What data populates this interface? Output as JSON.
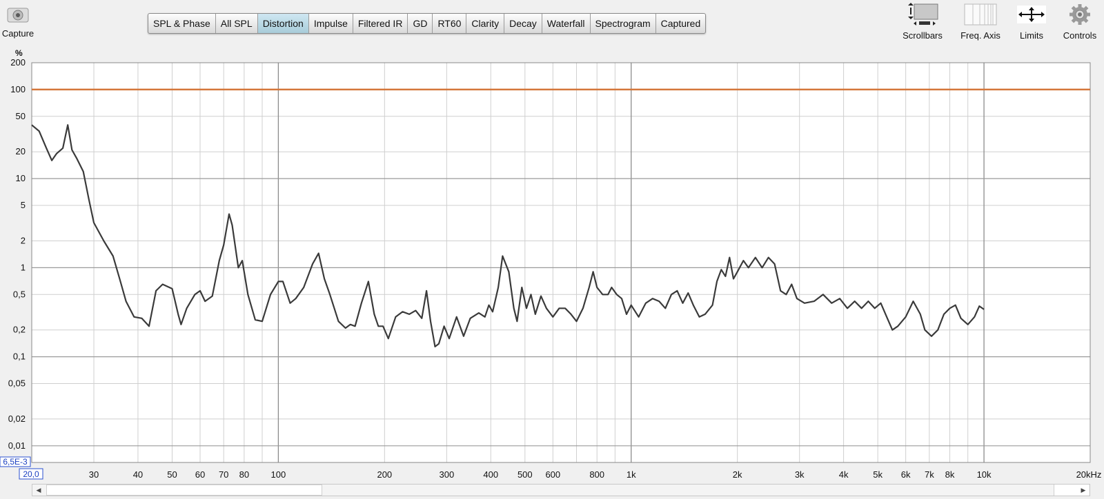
{
  "toolbar": {
    "capture_label": "Capture",
    "tabs": [
      {
        "label": "SPL & Phase",
        "active": false
      },
      {
        "label": "All SPL",
        "active": false
      },
      {
        "label": "Distortion",
        "active": true
      },
      {
        "label": "Impulse",
        "active": false
      },
      {
        "label": "Filtered IR",
        "active": false
      },
      {
        "label": "GD",
        "active": false
      },
      {
        "label": "RT60",
        "active": false
      },
      {
        "label": "Clarity",
        "active": false
      },
      {
        "label": "Decay",
        "active": false
      },
      {
        "label": "Waterfall",
        "active": false
      },
      {
        "label": "Spectrogram",
        "active": false
      },
      {
        "label": "Captured",
        "active": false
      }
    ],
    "right_tools": [
      {
        "label": "Scrollbars",
        "icon": "scrollbars-icon"
      },
      {
        "label": "Freq. Axis",
        "icon": "freq-axis-icon"
      },
      {
        "label": "Limits",
        "icon": "limits-icon"
      },
      {
        "label": "Controls",
        "icon": "gear-icon"
      }
    ]
  },
  "chart": {
    "y_unit": "%",
    "y_min_label": "6,5E-3",
    "x_min_label": "20,0",
    "x_max_label": "20kHz"
  },
  "chart_data": {
    "type": "line",
    "title": "",
    "xlabel": "",
    "ylabel": "%",
    "x_scale": "log",
    "y_scale": "log",
    "xlim": [
      20,
      20000
    ],
    "ylim": [
      0.0065,
      200
    ],
    "grid": true,
    "x_ticks": [
      {
        "v": 30,
        "label": "30"
      },
      {
        "v": 40,
        "label": "40"
      },
      {
        "v": 50,
        "label": "50"
      },
      {
        "v": 60,
        "label": "60"
      },
      {
        "v": 70,
        "label": "70"
      },
      {
        "v": 80,
        "label": "80"
      },
      {
        "v": 100,
        "label": "100"
      },
      {
        "v": 200,
        "label": "200"
      },
      {
        "v": 300,
        "label": "300"
      },
      {
        "v": 400,
        "label": "400"
      },
      {
        "v": 500,
        "label": "500"
      },
      {
        "v": 600,
        "label": "600"
      },
      {
        "v": 800,
        "label": "800"
      },
      {
        "v": 1000,
        "label": "1k"
      },
      {
        "v": 2000,
        "label": "2k"
      },
      {
        "v": 3000,
        "label": "3k"
      },
      {
        "v": 4000,
        "label": "4k"
      },
      {
        "v": 5000,
        "label": "5k"
      },
      {
        "v": 6000,
        "label": "6k"
      },
      {
        "v": 7000,
        "label": "7k"
      },
      {
        "v": 8000,
        "label": "8k"
      },
      {
        "v": 10000,
        "label": "10k"
      }
    ],
    "y_ticks": [
      {
        "v": 200,
        "label": "200"
      },
      {
        "v": 100,
        "label": "100"
      },
      {
        "v": 50,
        "label": "50"
      },
      {
        "v": 20,
        "label": "20"
      },
      {
        "v": 10,
        "label": "10"
      },
      {
        "v": 5,
        "label": "5"
      },
      {
        "v": 2,
        "label": "2"
      },
      {
        "v": 1,
        "label": "1"
      },
      {
        "v": 0.5,
        "label": "0,5"
      },
      {
        "v": 0.2,
        "label": "0,2"
      },
      {
        "v": 0.1,
        "label": "0,1"
      },
      {
        "v": 0.05,
        "label": "0,05"
      },
      {
        "v": 0.02,
        "label": "0,02"
      },
      {
        "v": 0.01,
        "label": "0,01"
      }
    ],
    "reference_line": {
      "y": 100,
      "color": "#d4763a"
    },
    "series": [
      {
        "color": "#3a3a3a",
        "points": [
          [
            20,
            40
          ],
          [
            21,
            34
          ],
          [
            22,
            22
          ],
          [
            22.8,
            16
          ],
          [
            23.5,
            19
          ],
          [
            24.5,
            22
          ],
          [
            25.3,
            40
          ],
          [
            26,
            21
          ],
          [
            26.8,
            17
          ],
          [
            28,
            12
          ],
          [
            29,
            6
          ],
          [
            30,
            3.2
          ],
          [
            32,
            2.0
          ],
          [
            34,
            1.35
          ],
          [
            35.5,
            0.75
          ],
          [
            37,
            0.42
          ],
          [
            39,
            0.28
          ],
          [
            41,
            0.27
          ],
          [
            43,
            0.22
          ],
          [
            45,
            0.55
          ],
          [
            47,
            0.65
          ],
          [
            50,
            0.58
          ],
          [
            52,
            0.3
          ],
          [
            53,
            0.23
          ],
          [
            55,
            0.35
          ],
          [
            58,
            0.5
          ],
          [
            60,
            0.55
          ],
          [
            62,
            0.42
          ],
          [
            65,
            0.48
          ],
          [
            68,
            1.2
          ],
          [
            70,
            1.8
          ],
          [
            72.5,
            4.0
          ],
          [
            74,
            3.0
          ],
          [
            77,
            1.0
          ],
          [
            79,
            1.2
          ],
          [
            82,
            0.5
          ],
          [
            86,
            0.26
          ],
          [
            90,
            0.25
          ],
          [
            95,
            0.5
          ],
          [
            100,
            0.7
          ],
          [
            103,
            0.7
          ],
          [
            108,
            0.4
          ],
          [
            112,
            0.45
          ],
          [
            118,
            0.6
          ],
          [
            125,
            1.1
          ],
          [
            130,
            1.45
          ],
          [
            135,
            0.75
          ],
          [
            140,
            0.5
          ],
          [
            148,
            0.25
          ],
          [
            155,
            0.21
          ],
          [
            160,
            0.23
          ],
          [
            165,
            0.22
          ],
          [
            172,
            0.4
          ],
          [
            180,
            0.7
          ],
          [
            187,
            0.3
          ],
          [
            192,
            0.22
          ],
          [
            198,
            0.22
          ],
          [
            205,
            0.16
          ],
          [
            215,
            0.28
          ],
          [
            225,
            0.32
          ],
          [
            235,
            0.3
          ],
          [
            245,
            0.33
          ],
          [
            255,
            0.27
          ],
          [
            263,
            0.55
          ],
          [
            270,
            0.25
          ],
          [
            278,
            0.13
          ],
          [
            285,
            0.14
          ],
          [
            295,
            0.22
          ],
          [
            305,
            0.16
          ],
          [
            320,
            0.28
          ],
          [
            335,
            0.17
          ],
          [
            350,
            0.27
          ],
          [
            370,
            0.31
          ],
          [
            385,
            0.28
          ],
          [
            395,
            0.38
          ],
          [
            405,
            0.32
          ],
          [
            420,
            0.6
          ],
          [
            432,
            1.35
          ],
          [
            450,
            0.9
          ],
          [
            465,
            0.35
          ],
          [
            475,
            0.25
          ],
          [
            490,
            0.6
          ],
          [
            505,
            0.35
          ],
          [
            520,
            0.5
          ],
          [
            535,
            0.3
          ],
          [
            555,
            0.48
          ],
          [
            575,
            0.35
          ],
          [
            600,
            0.28
          ],
          [
            625,
            0.35
          ],
          [
            650,
            0.35
          ],
          [
            675,
            0.3
          ],
          [
            700,
            0.25
          ],
          [
            730,
            0.35
          ],
          [
            760,
            0.6
          ],
          [
            780,
            0.9
          ],
          [
            800,
            0.6
          ],
          [
            830,
            0.5
          ],
          [
            860,
            0.5
          ],
          [
            880,
            0.6
          ],
          [
            910,
            0.5
          ],
          [
            940,
            0.45
          ],
          [
            970,
            0.3
          ],
          [
            1000,
            0.38
          ],
          [
            1050,
            0.28
          ],
          [
            1100,
            0.4
          ],
          [
            1150,
            0.45
          ],
          [
            1200,
            0.42
          ],
          [
            1250,
            0.35
          ],
          [
            1300,
            0.5
          ],
          [
            1350,
            0.55
          ],
          [
            1400,
            0.4
          ],
          [
            1450,
            0.52
          ],
          [
            1500,
            0.38
          ],
          [
            1560,
            0.28
          ],
          [
            1620,
            0.3
          ],
          [
            1700,
            0.38
          ],
          [
            1750,
            0.7
          ],
          [
            1800,
            0.95
          ],
          [
            1850,
            0.8
          ],
          [
            1900,
            1.3
          ],
          [
            1950,
            0.75
          ],
          [
            2000,
            0.9
          ],
          [
            2080,
            1.2
          ],
          [
            2150,
            1.0
          ],
          [
            2250,
            1.3
          ],
          [
            2350,
            1.0
          ],
          [
            2450,
            1.3
          ],
          [
            2550,
            1.1
          ],
          [
            2650,
            0.55
          ],
          [
            2750,
            0.5
          ],
          [
            2850,
            0.65
          ],
          [
            2950,
            0.45
          ],
          [
            3100,
            0.4
          ],
          [
            3300,
            0.42
          ],
          [
            3500,
            0.5
          ],
          [
            3700,
            0.4
          ],
          [
            3900,
            0.45
          ],
          [
            4100,
            0.35
          ],
          [
            4300,
            0.42
          ],
          [
            4500,
            0.35
          ],
          [
            4700,
            0.42
          ],
          [
            4900,
            0.35
          ],
          [
            5100,
            0.4
          ],
          [
            5300,
            0.28
          ],
          [
            5500,
            0.2
          ],
          [
            5700,
            0.22
          ],
          [
            6000,
            0.28
          ],
          [
            6300,
            0.42
          ],
          [
            6600,
            0.3
          ],
          [
            6800,
            0.2
          ],
          [
            7100,
            0.17
          ],
          [
            7400,
            0.2
          ],
          [
            7700,
            0.3
          ],
          [
            8000,
            0.35
          ],
          [
            8300,
            0.38
          ],
          [
            8600,
            0.27
          ],
          [
            9000,
            0.23
          ],
          [
            9400,
            0.28
          ],
          [
            9700,
            0.37
          ],
          [
            10000,
            0.34
          ]
        ]
      }
    ]
  }
}
